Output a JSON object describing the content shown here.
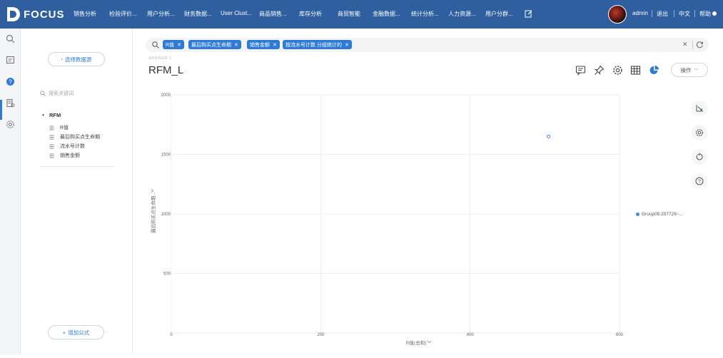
{
  "app": {
    "logo_text": "FOCUS"
  },
  "nav": {
    "items": [
      "销售分析",
      "检验评价...",
      "用户分析...",
      "财务数据...",
      "User Clust...",
      "商品销售...",
      "库存分析",
      "商贸智能",
      "金融数据...",
      "统计分析...",
      "人力资源...",
      "用户分群..."
    ]
  },
  "user": {
    "name": "admin",
    "logout": "退出",
    "language": "中文",
    "help": "帮助"
  },
  "sidebar": {
    "select_source_label": "选择数据源",
    "search_placeholder": "搜索关键词",
    "tree": {
      "root": "RFM",
      "items": [
        "R值",
        "最后购买点生命期",
        "流水号计数",
        "销售金额"
      ]
    },
    "add_formula_label": "增加公式"
  },
  "filter": {
    "chips": [
      "R值",
      "最后购买点生命期",
      "销售金额",
      "按流水号计数 分组统计的"
    ]
  },
  "report": {
    "breadcrumb": "ANSWER 1",
    "title": "RFM_L",
    "operate_label": "操作"
  },
  "colors": {
    "topbar": "#2f5f9f",
    "accent": "#2f7ad6",
    "point": "#3a8ee6"
  },
  "chart_data": {
    "type": "scatter",
    "xlabel": "R值(总和)",
    "ylabel": "最后购买点生命期...",
    "xlim": [
      0,
      600
    ],
    "ylim": [
      0,
      2000
    ],
    "x_ticks": [
      0,
      200,
      400,
      600
    ],
    "y_ticks": [
      500,
      1000,
      1500,
      2000
    ],
    "grid": true,
    "legend_position": "right",
    "series": [
      {
        "name": "Group05:257729~...",
        "points": [
          {
            "x": 505,
            "y": 1650
          }
        ]
      }
    ]
  }
}
